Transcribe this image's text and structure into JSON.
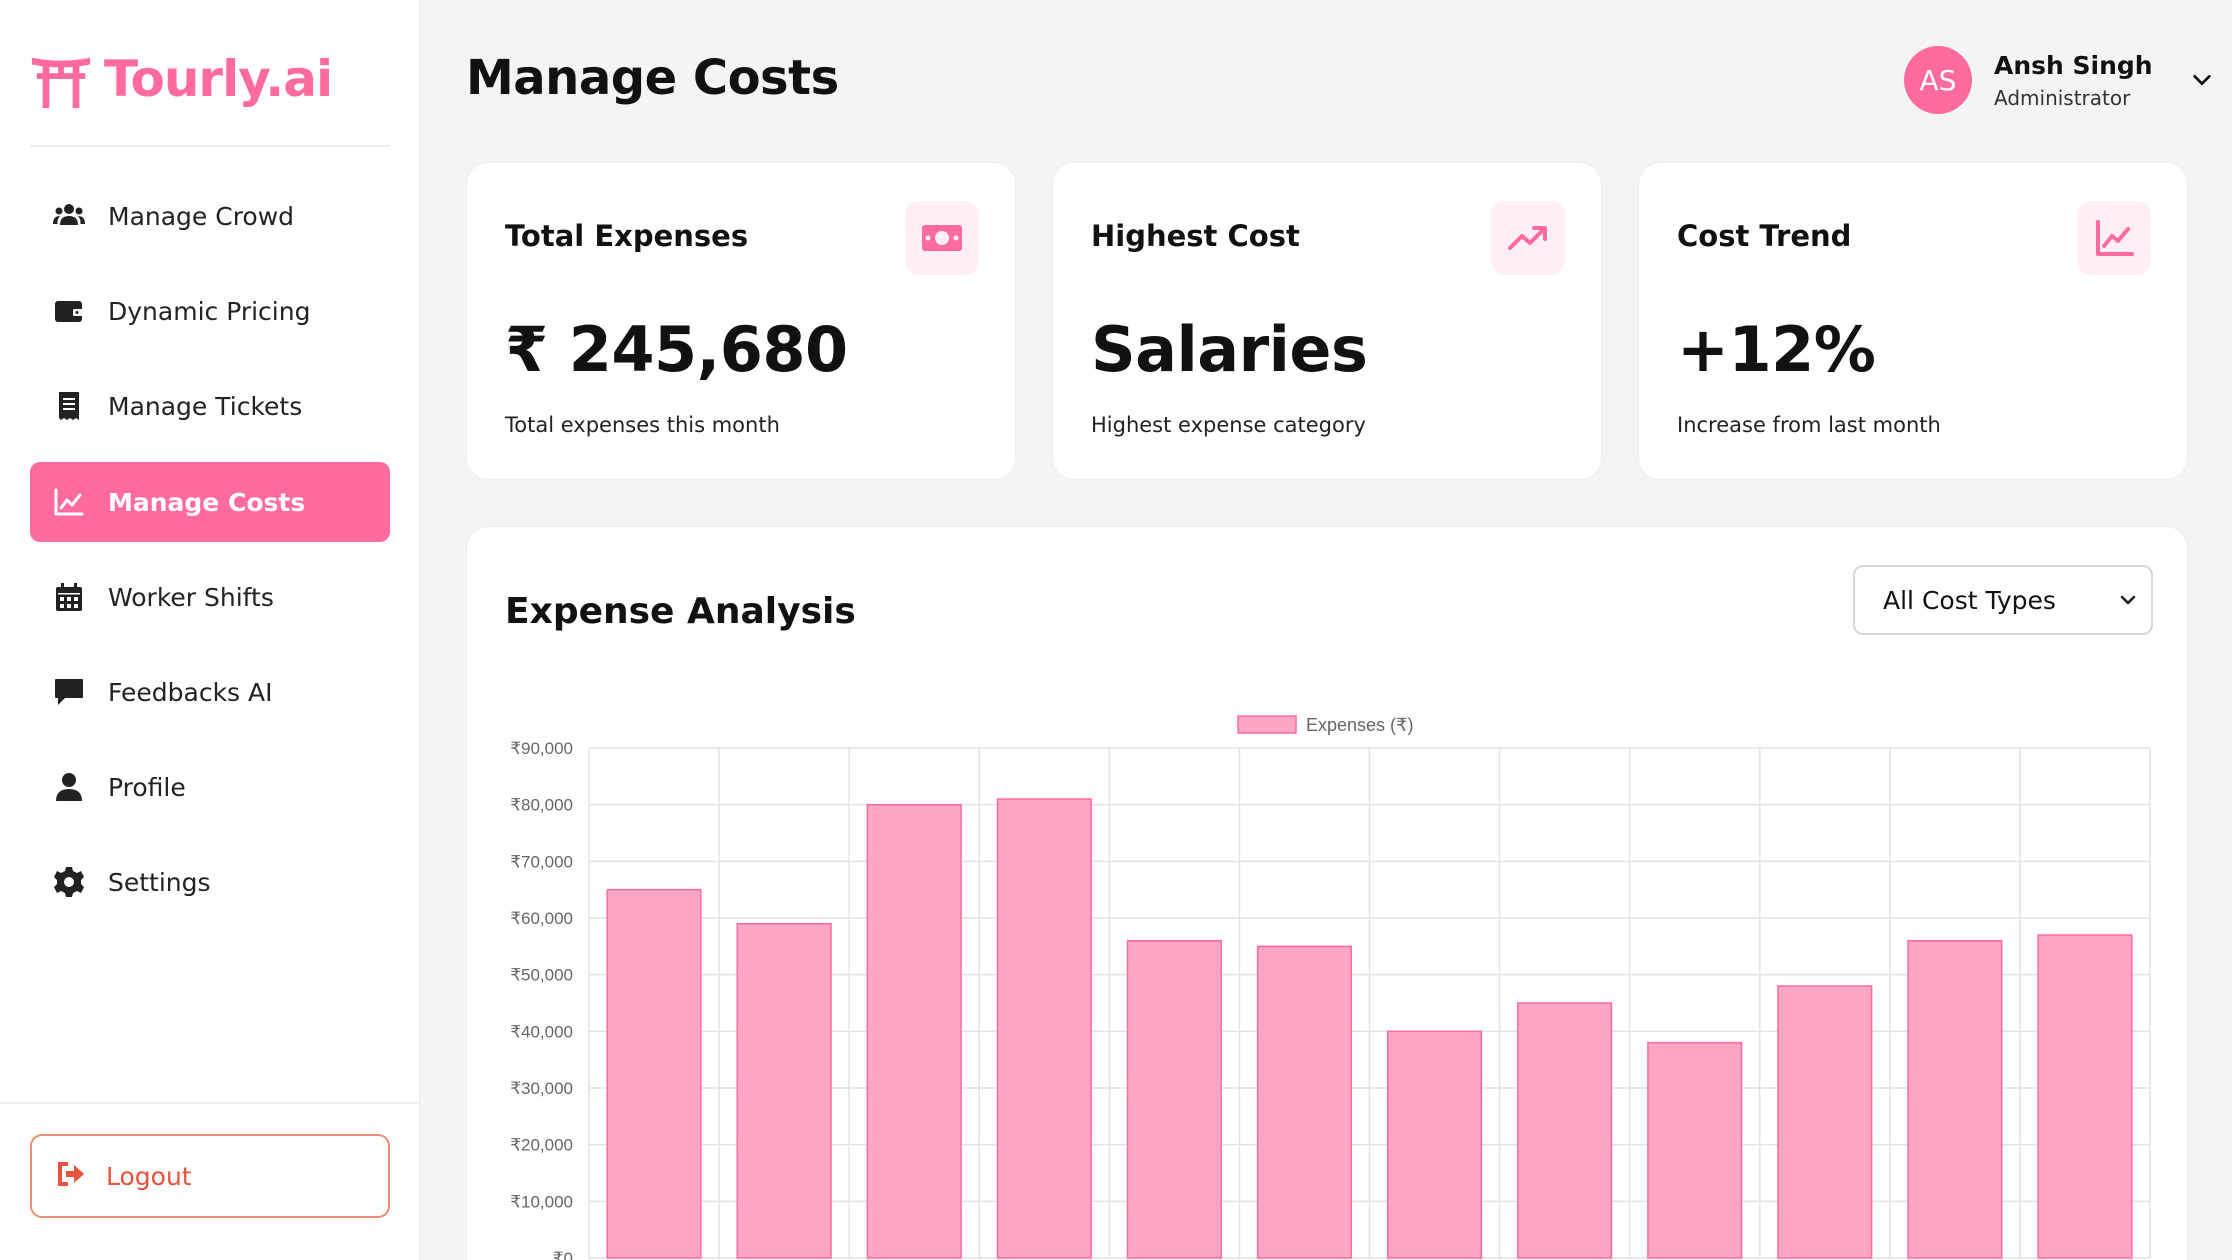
{
  "app": {
    "name": "Tourly.ai"
  },
  "sidebar": {
    "items": [
      {
        "label": "Manage Crowd",
        "icon": "users-icon",
        "active": false
      },
      {
        "label": "Dynamic Pricing",
        "icon": "wallet-icon",
        "active": false
      },
      {
        "label": "Manage Tickets",
        "icon": "receipt-icon",
        "active": false
      },
      {
        "label": "Manage Costs",
        "icon": "chart-line-icon",
        "active": true
      },
      {
        "label": "Worker Shifts",
        "icon": "calendar-icon",
        "active": false
      },
      {
        "label": "Feedbacks AI",
        "icon": "comment-icon",
        "active": false
      },
      {
        "label": "Profile",
        "icon": "user-icon",
        "active": false
      },
      {
        "label": "Settings",
        "icon": "gear-icon",
        "active": false
      }
    ],
    "logout_label": "Logout"
  },
  "header": {
    "title": "Manage Costs",
    "user": {
      "initials": "AS",
      "name": "Ansh Singh",
      "role": "Administrator"
    }
  },
  "cards": [
    {
      "title": "Total Expenses",
      "value": "₹ 245,680",
      "subtitle": "Total expenses this month",
      "icon": "money-bill-icon"
    },
    {
      "title": "Highest Cost",
      "value": "Salaries",
      "subtitle": "Highest expense category",
      "icon": "trending-up-icon"
    },
    {
      "title": "Cost Trend",
      "value": "+12%",
      "subtitle": "Increase from last month",
      "icon": "chart-line-icon"
    }
  ],
  "analysis": {
    "title": "Expense Analysis",
    "filter_selected": "All Cost Types"
  },
  "colors": {
    "accent": "#ff6b9d",
    "bar_fill": "#ffa6c3",
    "bar_stroke": "#ff6b9d",
    "logout": "#e8533b"
  },
  "chart_data": {
    "type": "bar",
    "categories": [
      "",
      "",
      "",
      "",
      "",
      "",
      "",
      "",
      "",
      "",
      "",
      ""
    ],
    "series": [
      {
        "name": "Expenses (₹)",
        "values": [
          65000,
          59000,
          80000,
          81000,
          56000,
          55000,
          40000,
          45000,
          38000,
          48000,
          56000,
          57000
        ]
      }
    ],
    "ylim": [
      0,
      90000
    ],
    "yticks": [
      "₹0",
      "₹10,000",
      "₹20,000",
      "₹30,000",
      "₹40,000",
      "₹50,000",
      "₹60,000",
      "₹70,000",
      "₹80,000",
      "₹90,000"
    ],
    "legend": "top-center",
    "grid": true
  }
}
